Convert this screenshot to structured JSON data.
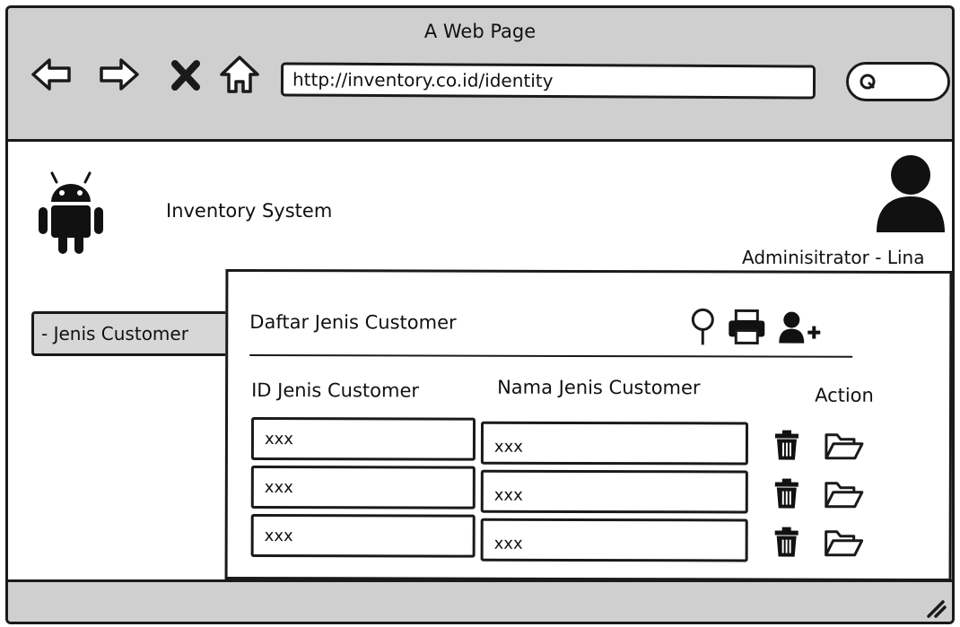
{
  "browser": {
    "title": "A Web Page",
    "url": "http://inventory.co.id/identity",
    "nav_icons": [
      "back-arrow-icon",
      "forward-arrow-icon",
      "close-x-icon",
      "home-icon"
    ],
    "search_icon": "search-icon"
  },
  "header": {
    "logo_icon": "android-icon",
    "app_name": "Inventory System",
    "avatar_icon": "user-icon",
    "user_label": "Adminisitrator - Lina"
  },
  "sidebar": {
    "items": [
      {
        "label": "- Jenis Customer"
      }
    ]
  },
  "panel": {
    "title": "Daftar Jenis Customer",
    "toolbar_icons": [
      "search-icon",
      "print-icon",
      "add-user-icon"
    ],
    "columns": [
      "ID Jenis Customer",
      "Nama Jenis Customer",
      "Action"
    ],
    "rows": [
      {
        "id": "xxx",
        "nama": "xxx",
        "actions": [
          "trash-icon",
          "folder-open-icon"
        ]
      },
      {
        "id": "xxx",
        "nama": "xxx",
        "actions": [
          "trash-icon",
          "folder-open-icon"
        ]
      },
      {
        "id": "xxx",
        "nama": "xxx",
        "actions": [
          "trash-icon",
          "folder-open-icon"
        ]
      }
    ]
  }
}
